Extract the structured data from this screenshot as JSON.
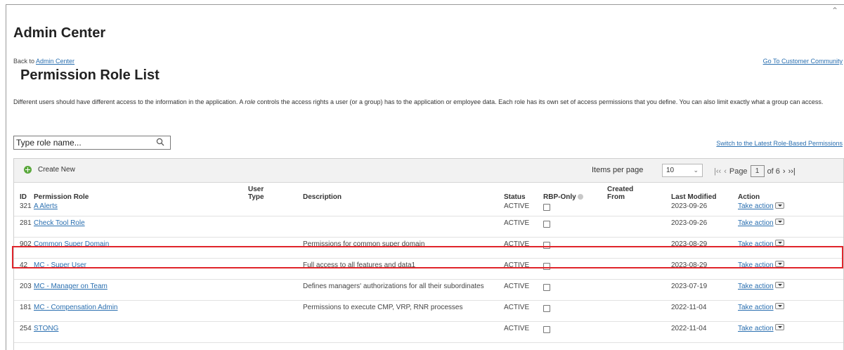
{
  "header": {
    "title": "Admin Center",
    "back_prefix": "Back to",
    "back_link": "Admin Center",
    "community_link": "Go To Customer Community",
    "page_title": "Permission Role List",
    "intro_part1": "Different users should have different access to the information in the application. A",
    "intro_role_word": "role",
    "intro_part2": "controls the access rights a user (or a group) has to the application or employee data. Each role has its own set of access permissions that you define. You can also limit exactly what a group can access."
  },
  "search": {
    "placeholder": "Type role name...",
    "icon": "search-icon"
  },
  "switch_link": "Switch to the Latest Role-Based Permissions",
  "toolbar": {
    "create_new": "Create New",
    "items_per_page_label": "Items per page",
    "items_per_page_value": "10",
    "page_label": "Page",
    "current_page": "1",
    "of_pages": "of 6"
  },
  "table": {
    "headers": {
      "id": "ID",
      "role": "Permission Role",
      "user_type_1": "User",
      "user_type_2": "Type",
      "description": "Description",
      "status": "Status",
      "rbp_only": "RBP-Only",
      "created_from_1": "Created",
      "created_from_2": "From",
      "last_modified": "Last Modified",
      "action": "Action"
    },
    "action_label": "Take action",
    "rows": [
      {
        "id": "321",
        "role": "A Alerts",
        "description": "",
        "status": "ACTIVE",
        "modified": "2023-09-26"
      },
      {
        "id": "281",
        "role": "Check Tool Role",
        "description": "",
        "status": "ACTIVE",
        "modified": "2023-09-26"
      },
      {
        "id": "902",
        "role": "Common Super Domain",
        "description": "Permissions for common super domain",
        "status": "ACTIVE",
        "modified": "2023-08-29"
      },
      {
        "id": "42",
        "role": "MC - Super User",
        "description": "Full access to all features and data1",
        "status": "ACTIVE",
        "modified": "2023-08-29"
      },
      {
        "id": "203",
        "role": "MC - Manager on Team",
        "description": "Defines managers' authorizations for all their subordinates",
        "status": "ACTIVE",
        "modified": "2023-07-19"
      },
      {
        "id": "181",
        "role": "MC - Compensation Admin",
        "description": "Permissions to execute CMP, VRP, RNR processes",
        "status": "ACTIVE",
        "modified": "2022-11-04"
      },
      {
        "id": "254",
        "role": "STONG",
        "description": "",
        "status": "ACTIVE",
        "modified": "2022-11-04"
      }
    ]
  },
  "colors": {
    "link": "#2a6fb0",
    "highlight": "#e0252b",
    "create_icon": "#5aa83c"
  }
}
